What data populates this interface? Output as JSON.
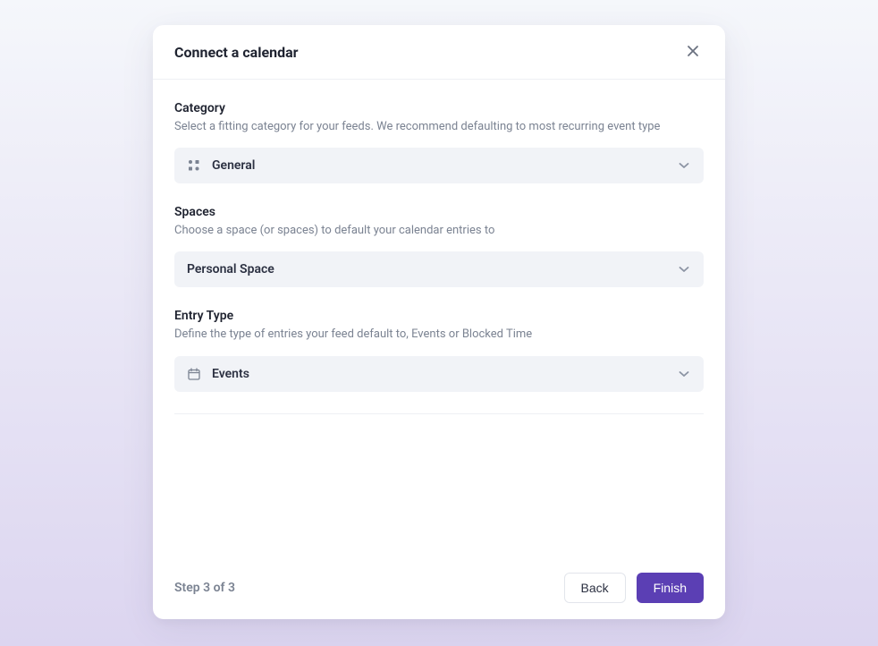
{
  "modal": {
    "title": "Connect a calendar",
    "step_indicator": "Step 3 of 3",
    "back_label": "Back",
    "finish_label": "Finish"
  },
  "category": {
    "title": "Category",
    "description": "Select a fitting category for your feeds. We recommend defaulting to most recurring event type",
    "selected": "General"
  },
  "spaces": {
    "title": "Spaces",
    "description": "Choose a space (or spaces) to default your calendar entries to",
    "selected": "Personal Space"
  },
  "entry_type": {
    "title": "Entry Type",
    "description": "Define the type of entries your feed default to, Events or Blocked Time",
    "selected": "Events"
  }
}
